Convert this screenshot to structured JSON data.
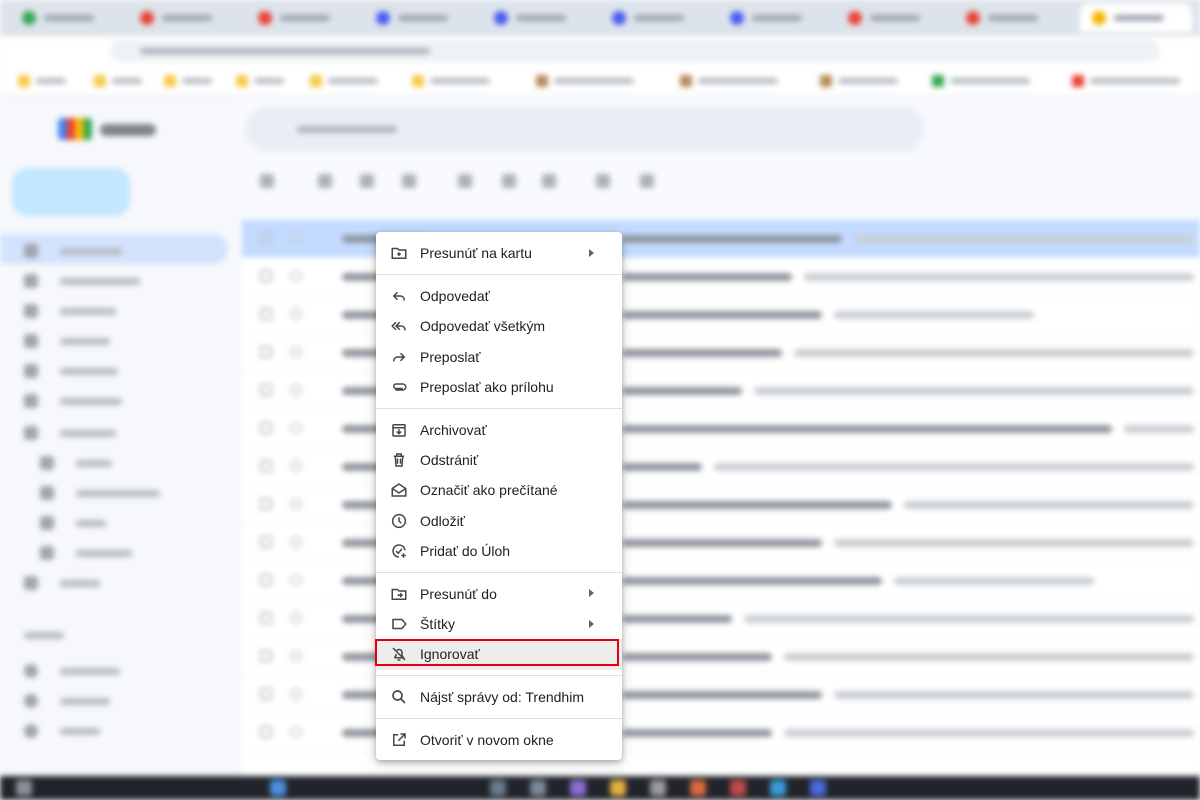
{
  "context_menu": {
    "items": [
      {
        "label": "Presunúť na kartu",
        "icon": "move-to-tab-icon",
        "submenu": true
      },
      {
        "label": "Odpovedať",
        "icon": "reply-icon"
      },
      {
        "label": "Odpovedať všetkým",
        "icon": "reply-all-icon"
      },
      {
        "label": "Preposlať",
        "icon": "forward-icon"
      },
      {
        "label": "Preposlať ako prílohu",
        "icon": "attachment-icon"
      },
      {
        "label": "Archivovať",
        "icon": "archive-icon"
      },
      {
        "label": "Odstrániť",
        "icon": "trash-icon"
      },
      {
        "label": "Označiť ako prečítané",
        "icon": "mark-read-icon"
      },
      {
        "label": "Odložiť",
        "icon": "snooze-clock-icon"
      },
      {
        "label": "Pridať do Úloh",
        "icon": "add-task-icon"
      },
      {
        "label": "Presunúť do",
        "icon": "move-to-folder-icon",
        "submenu": true
      },
      {
        "label": "Štítky",
        "icon": "label-icon",
        "submenu": true
      },
      {
        "label": "Ignorovať",
        "icon": "mute-icon",
        "highlighted": true
      },
      {
        "label": "Nájsť správy od: Trendhim",
        "icon": "search-icon"
      },
      {
        "label": "Otvoriť v novom okne",
        "icon": "open-new-window-icon"
      }
    ],
    "highlight_color": "#e2000f"
  }
}
